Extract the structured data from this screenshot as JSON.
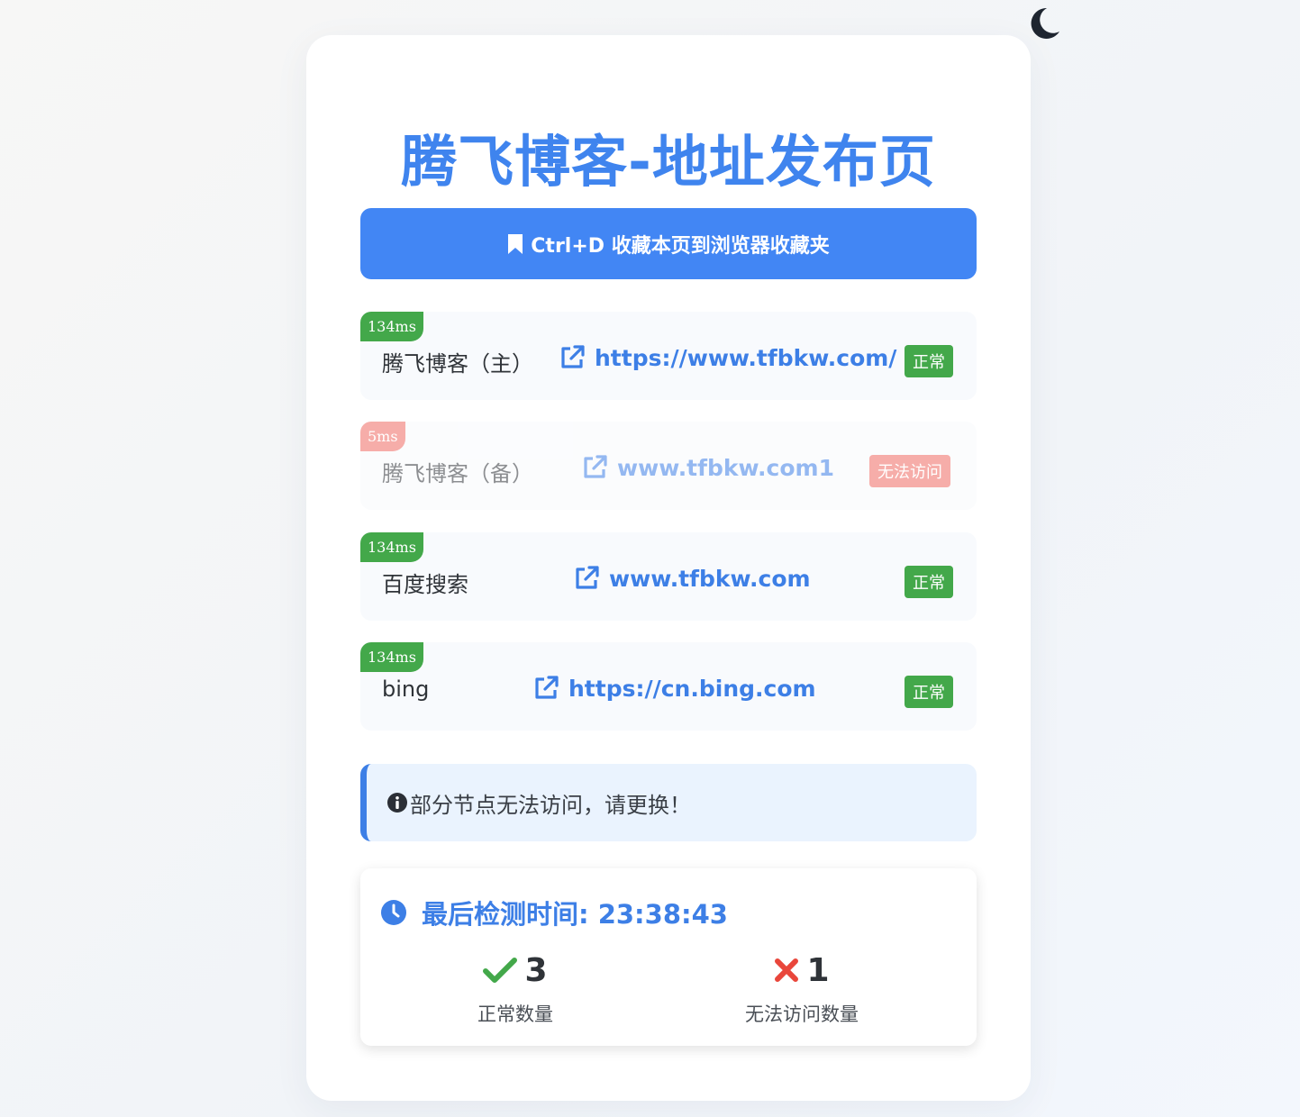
{
  "page": {
    "title": "腾飞博客-地址发布页",
    "bookmark_label": "Ctrl+D 收藏本页到浏览器收藏夹"
  },
  "colors": {
    "accent": "#4286f4",
    "ok": "#43a84a",
    "bad": "#f06b63",
    "notice_bg": "#eaf3fe"
  },
  "links": [
    {
      "latency": "134ms",
      "name": "腾飞博客（主）",
      "url": "https://www.tfbkw.com/",
      "status": "正常"
    },
    {
      "latency": "5ms",
      "name": "腾飞博客（备）",
      "url": "www.tfbkw.com1",
      "status": "无法访问"
    },
    {
      "latency": "134ms",
      "name": "百度搜索",
      "url": "www.tfbkw.com",
      "status": "正常"
    },
    {
      "latency": "134ms",
      "name": "bing",
      "url": "https://cn.bing.com",
      "status": "正常"
    }
  ],
  "notice": {
    "text": "部分节点无法访问，请更换！",
    "icon": "info-circle-icon"
  },
  "stats": {
    "last_check_label": "最后检测时间: 23:38:43",
    "ok_count": "3",
    "ok_label": "正常数量",
    "fail_count": "1",
    "fail_label": "无法访问数量"
  },
  "icons": {
    "theme_toggle": "moon-icon",
    "bookmark": "bookmark-icon",
    "link": "external-link-icon",
    "clock": "clock-icon",
    "check": "check-icon",
    "cross": "x-icon"
  }
}
